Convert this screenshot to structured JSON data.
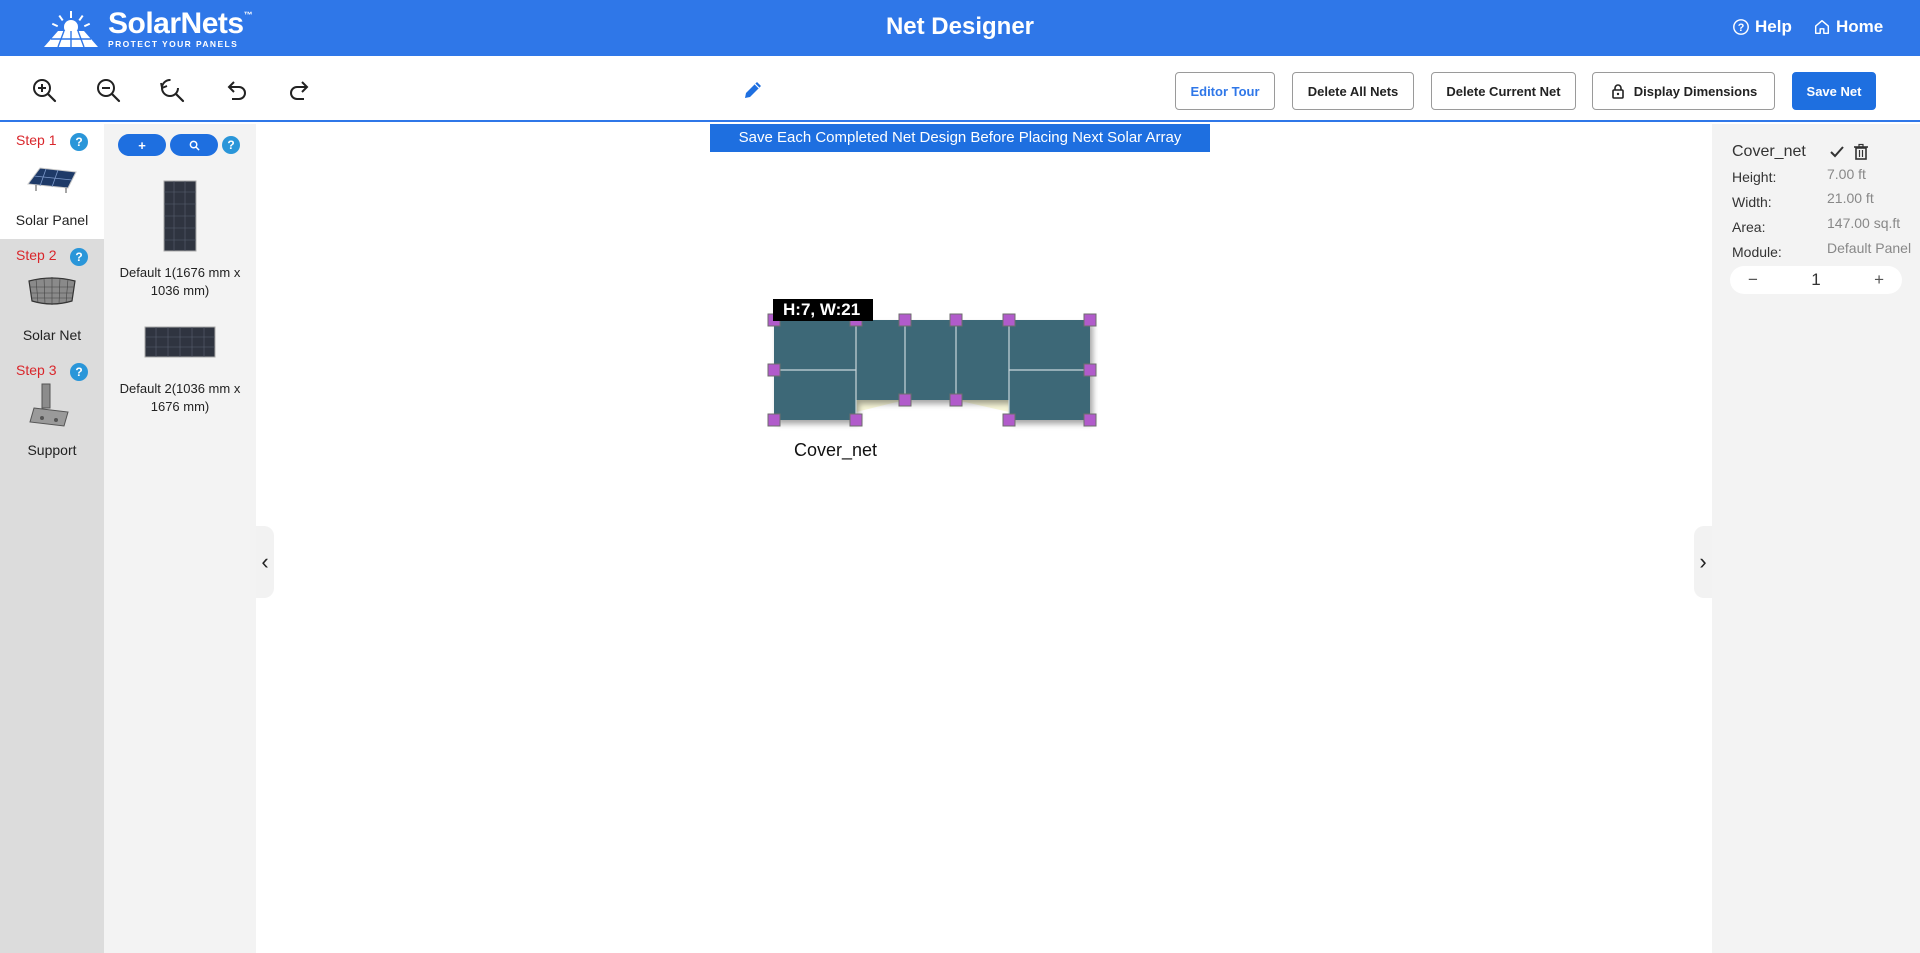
{
  "header": {
    "brand_name": "SolarNets",
    "brand_tm": "™",
    "brand_tagline": "PROTECT YOUR PANELS",
    "title": "Net Designer",
    "help_label": "Help",
    "home_label": "Home",
    "color": "#2f77e8"
  },
  "toolbar": {
    "tools": [
      "zoom-in-icon",
      "zoom-out-icon",
      "zoom-reset-icon",
      "undo-icon",
      "redo-icon",
      "pencil-icon"
    ],
    "editor_tour_label": "Editor Tour",
    "delete_all_label": "Delete All Nets",
    "delete_current_label": "Delete Current Net",
    "display_dimensions_label": "Display Dimensions",
    "save_net_label": "Save Net"
  },
  "steps": [
    {
      "label": "Step 1",
      "name": "Solar Panel",
      "help": "?"
    },
    {
      "label": "Step 2",
      "name": "Solar Net",
      "help": "?"
    },
    {
      "label": "Step 3",
      "name": "Support",
      "help": "?"
    }
  ],
  "modules_panel": {
    "add_label": "+",
    "search_label": "🔍",
    "help": "?",
    "modules": [
      {
        "name": "Default 1(1676 mm x 1036 mm)"
      },
      {
        "name": "Default 2(1036 mm x 1676 mm)"
      }
    ]
  },
  "canvas": {
    "notice": "Save Each Completed Net Design Before Placing Next Solar Array",
    "dimension_label": "H:7, W:21",
    "net_name": "Cover_net",
    "collapse_left": "‹",
    "collapse_right": "›"
  },
  "properties": {
    "net_name": "Cover_net",
    "height_label": "Height:",
    "height_value": "7.00 ft",
    "width_label": "Width:",
    "width_value": "21.00 ft",
    "area_label": "Area:",
    "area_value": "147.00 sq.ft",
    "module_label": "Module:",
    "module_value": "Default Panel",
    "quantity": "1",
    "minus": "−",
    "plus": "+"
  }
}
